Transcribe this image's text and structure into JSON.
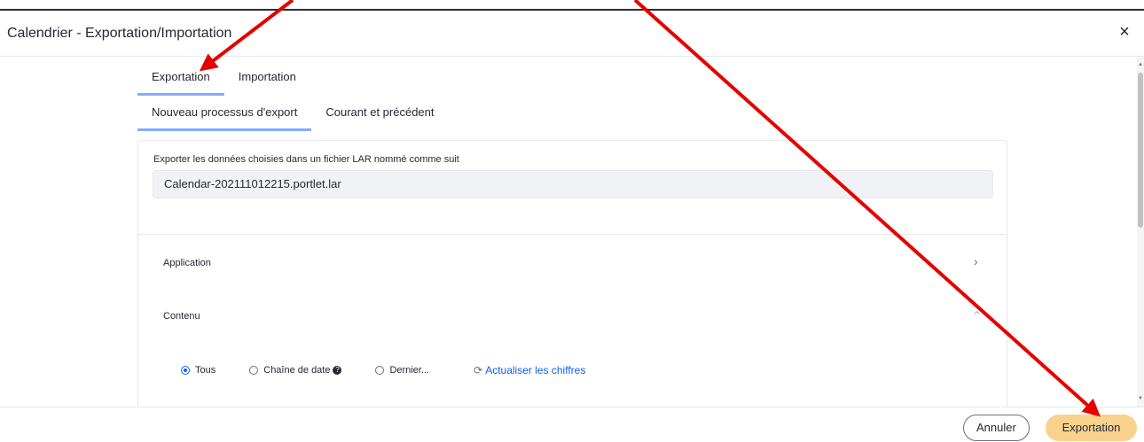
{
  "modal": {
    "title": "Calendrier - Exportation/Importation",
    "close_symbol": "×"
  },
  "tabs_primary": [
    {
      "label": "Exportation",
      "active": true
    },
    {
      "label": "Importation",
      "active": false
    }
  ],
  "tabs_secondary": [
    {
      "label": "Nouveau processus d'export",
      "active": true
    },
    {
      "label": "Courant et précédent",
      "active": false
    }
  ],
  "export": {
    "label": "Exporter les données choisies dans un fichier LAR nommé comme suit",
    "filename": "Calendar-202111012215.portlet.lar"
  },
  "sections": {
    "application": "Application",
    "contenu": "Contenu"
  },
  "range_options": [
    {
      "label": "Tous",
      "checked": true
    },
    {
      "label": "Chaîne de date",
      "checked": false
    },
    {
      "label": "Dernier...",
      "checked": false
    }
  ],
  "refresh_label": "Actualiser les chiffres",
  "footer": {
    "cancel_label": "Annuler",
    "export_label": "Exportation"
  },
  "colors": {
    "accent_underline": "#80acff",
    "link_blue": "#0b5fff",
    "export_button": "#f8d38e",
    "annotation_arrow": "#e60000"
  },
  "icons": {
    "close": "close-icon",
    "chevron": "chevron-right-icon",
    "help": "help-icon",
    "refresh": "refresh-icon"
  }
}
